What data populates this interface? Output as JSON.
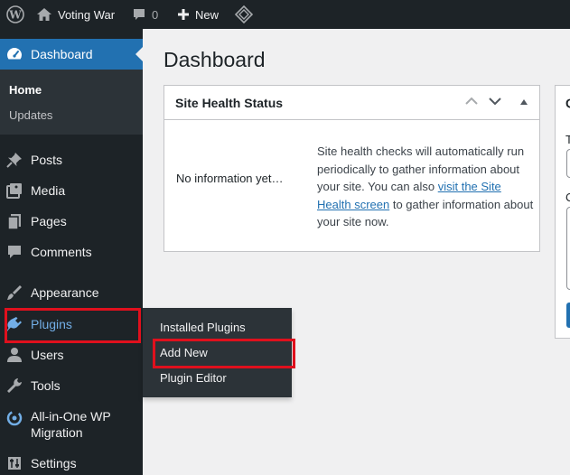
{
  "adminbar": {
    "wp_icon": "wordpress-logo-icon",
    "site_icon": "home-icon",
    "site_name": "Voting War",
    "comments_icon": "speech-bubble-icon",
    "comments_count": "0",
    "new_icon": "plus-icon",
    "new_label": "New",
    "diamond_icon": "diamond-icon"
  },
  "sidebar": {
    "dashboard": {
      "label": "Dashboard",
      "icon": "gauge-icon"
    },
    "submenu": {
      "home": "Home",
      "updates": "Updates"
    },
    "items": [
      {
        "label": "Posts",
        "icon": "pushpin-icon"
      },
      {
        "label": "Media",
        "icon": "media-icon"
      },
      {
        "label": "Pages",
        "icon": "pages-icon"
      },
      {
        "label": "Comments",
        "icon": "comment-icon"
      },
      {
        "label": "Appearance",
        "icon": "paintbrush-icon"
      },
      {
        "label": "Plugins",
        "icon": "plug-icon"
      },
      {
        "label": "Users",
        "icon": "user-icon"
      },
      {
        "label": "Tools",
        "icon": "wrench-icon"
      },
      {
        "label": "All-in-One WP",
        "label2": "Migration",
        "icon": "migration-icon"
      },
      {
        "label": "Settings",
        "icon": "settings-sliders-icon"
      }
    ]
  },
  "flyout": {
    "installed": "Installed Plugins",
    "add_new": "Add New",
    "editor": "Plugin Editor"
  },
  "main": {
    "title": "Dashboard",
    "site_health": {
      "title": "Site Health Status",
      "no_info": "No information yet…",
      "text_before": "Site health checks will automatically run periodically to gather information about your site. You can also ",
      "link": "visit the Site Health screen",
      "text_after": " to gather information about your site now."
    },
    "quick_draft_letter": "Q",
    "quick_draft_label1": "T",
    "quick_draft_label2": "C"
  },
  "colors": {
    "adminbar_bg": "#1d2327",
    "sidebar_bg": "#1d2327",
    "accent": "#2271b1",
    "active_link": "#72aee6",
    "highlight": "#e0101d"
  }
}
